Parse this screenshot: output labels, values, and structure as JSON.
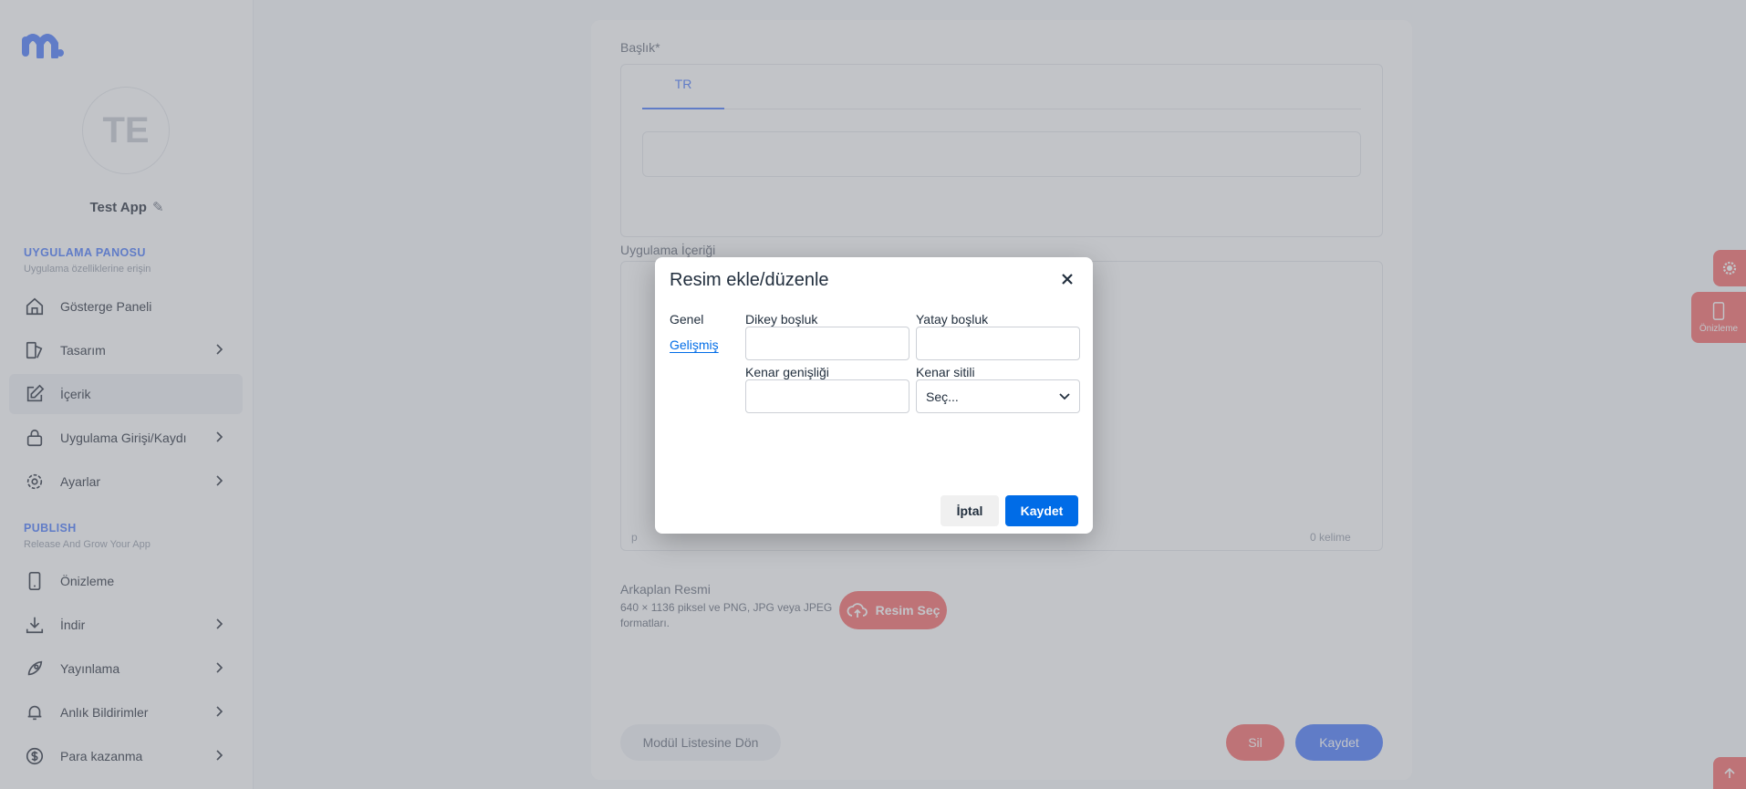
{
  "sidebar": {
    "avatar_initials": "TE",
    "app_name": "Test App",
    "section1": {
      "title": "UYGULAMA PANOSU",
      "subtitle": "Uygulama özelliklerine erişin"
    },
    "section2": {
      "title": "PUBLISH",
      "subtitle": "Release And Grow Your App"
    },
    "items": [
      {
        "label": "Gösterge Paneli"
      },
      {
        "label": "Tasarım"
      },
      {
        "label": "İçerik"
      },
      {
        "label": "Uygulama Girişi/Kaydı"
      },
      {
        "label": "Ayarlar"
      },
      {
        "label": "Önizleme"
      },
      {
        "label": "İndir"
      },
      {
        "label": "Yayınlama"
      },
      {
        "label": "Anlık Bildirimler"
      },
      {
        "label": "Para kazanma"
      }
    ]
  },
  "main": {
    "title_label": "Başlık*",
    "lang_tab": "TR",
    "content_label": "Uygulama İçeriği",
    "editor_statusbar_tag": "p",
    "editor_word_count": "0 kelime",
    "bg_label": "Arkaplan Resmi",
    "bg_hint": "640 × 1136 piksel ve PNG, JPG veya JPEG formatları.",
    "select_image_button": "Resim Seç",
    "back_button": "Modül Listesine Dön",
    "delete_button": "Sil",
    "save_button": "Kaydet"
  },
  "float_tabs": {
    "preview": "Önizleme"
  },
  "dialog": {
    "title": "Resim ekle/düzenle",
    "tabs": [
      "Genel",
      "Gelişmiş"
    ],
    "fields": {
      "vertical_space": "Dikey boşluk",
      "horizontal_space": "Yatay boşluk",
      "border_width": "Kenar genişliği",
      "border_style": "Kenar sitili",
      "border_style_value": "Seç..."
    },
    "cancel": "İptal",
    "save": "Kaydet"
  },
  "colors": {
    "accent": "#4d7cfe",
    "dialog_primary": "#006ce7",
    "danger": "#f76c6c"
  }
}
